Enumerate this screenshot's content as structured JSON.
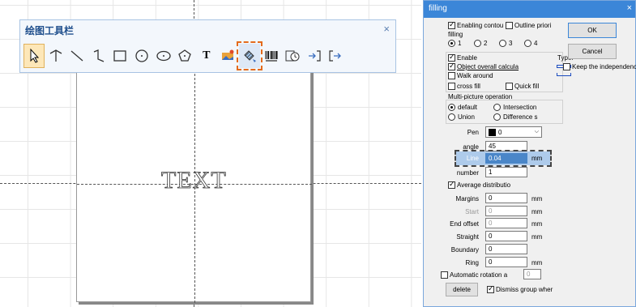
{
  "toolbar": {
    "title": "绘图工具栏",
    "close": "×",
    "tools": [
      {
        "name": "select-arrow-icon",
        "state": "active"
      },
      {
        "name": "node-edit-icon"
      },
      {
        "name": "line-icon"
      },
      {
        "name": "curve-icon"
      },
      {
        "name": "rectangle-icon"
      },
      {
        "name": "circle-icon"
      },
      {
        "name": "ellipse-icon"
      },
      {
        "name": "polygon-icon"
      },
      {
        "name": "text-icon",
        "label": "T"
      },
      {
        "name": "image-icon"
      },
      {
        "name": "fill-hatch-icon",
        "state": "highlighted"
      },
      {
        "name": "barcode-icon"
      },
      {
        "name": "timer-icon"
      },
      {
        "name": "input-port-icon"
      },
      {
        "name": "output-port-icon"
      }
    ]
  },
  "canvas": {
    "paper_text": "TEXT"
  },
  "dialog": {
    "title": "filling",
    "close": "×",
    "enabling_contour": "Enabling contou",
    "outline_priority": "Outline priori",
    "filling_group_label": "filling",
    "filling_options": [
      "1",
      "2",
      "3",
      "4"
    ],
    "enable": "Enable",
    "type_label": "Type:",
    "object_overall": "Object overall calcula",
    "walk_around": "Walk around",
    "cross_fill": "cross fill",
    "quick_fill": "Quick fill",
    "multi_label": "Multi-picture operation",
    "multi_default": "default",
    "multi_intersection": "Intersection",
    "multi_union": "Union",
    "multi_difference": "Difference s",
    "pen_label": "Pen",
    "pen_value": "0",
    "angle_label": "angle",
    "angle_value": "45",
    "line_label": "Line",
    "line_value": "0.04",
    "line_unit": "mm",
    "number_label": "number",
    "number_value": "1",
    "average_distribution": "Average distributio",
    "margins_label": "Margins",
    "margins_value": "0",
    "margins_unit": "mm",
    "start_label": "Start",
    "start_value": "0",
    "start_unit": "mm",
    "end_offset_label": "End offset",
    "end_offset_value": "0",
    "end_offset_unit": "mm",
    "straight_label": "Straight",
    "straight_value": "0",
    "straight_unit": "mm",
    "boundary_label": "Boundary",
    "boundary_value": "0",
    "ring_label": "Ring",
    "ring_value": "0",
    "ring_unit": "mm",
    "auto_rotation": "Automatic rotation a",
    "auto_rotation_value": "0",
    "delete_label": "delete",
    "dismiss_group": "Dismiss group wher",
    "ok_label": "OK",
    "cancel_label": "Cancel",
    "keep_independence": "Keep the independence"
  }
}
